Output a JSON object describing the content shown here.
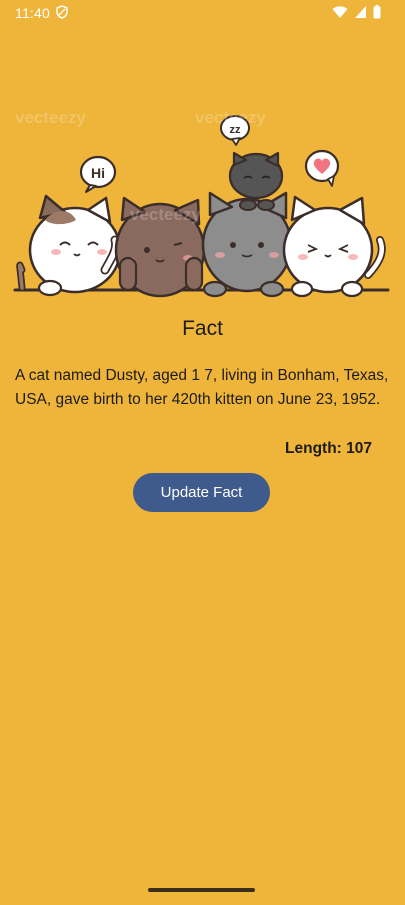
{
  "status_bar": {
    "time": "11:40",
    "icons": [
      "shield-icon",
      "wifi-icon",
      "signal-icon",
      "battery-icon"
    ]
  },
  "hero": {
    "description_icon": "cats-illustration",
    "speech_bubble_left": "Hi",
    "speech_bubble_top": "zz",
    "watermark": "vecteezy"
  },
  "content": {
    "title": "Fact",
    "fact": "A cat named Dusty, aged 1 7, living in Bonham, Texas, USA, gave birth to her 420th kitten on June 23, 1952.",
    "length_label": "Length: 107"
  },
  "actions": {
    "update_label": "Update Fact"
  },
  "colors": {
    "background": "#EFB43A",
    "button": "#3F5A8C",
    "text": "#1c1c1c"
  }
}
